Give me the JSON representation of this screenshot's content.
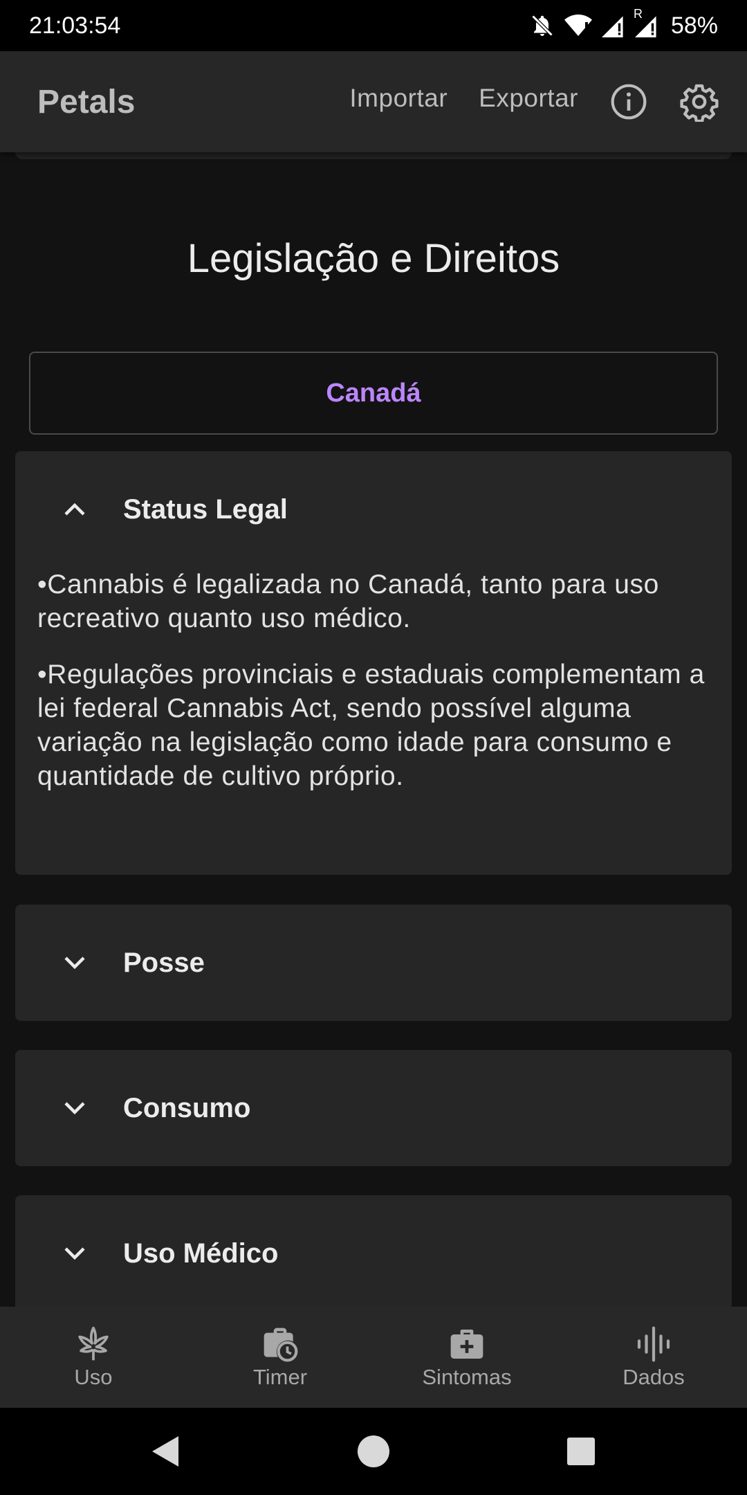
{
  "status_bar": {
    "time": "21:03:54",
    "battery": "58%",
    "signal_label": "R"
  },
  "app_bar": {
    "title": "Petals",
    "import_label": "Importar",
    "export_label": "Exportar"
  },
  "page": {
    "title": "Legislação e Direitos",
    "country": "Canadá"
  },
  "panels": [
    {
      "title": "Status Legal",
      "expanded": true,
      "paragraphs": [
        "•Cannabis é legalizada no Canadá, tanto para uso recreativo quanto uso médico.",
        "•Regulações provinciais e estaduais complementam a lei federal Cannabis Act, sendo possível alguma variação na legislação como idade para consumo e quantidade de cultivo próprio."
      ]
    },
    {
      "title": "Posse",
      "expanded": false
    },
    {
      "title": "Consumo",
      "expanded": false
    },
    {
      "title": "Uso Médico",
      "expanded": false
    }
  ],
  "bottom_nav": [
    {
      "label": "Uso",
      "icon": "cannabis-leaf-icon"
    },
    {
      "label": "Timer",
      "icon": "timer-bag-icon"
    },
    {
      "label": "Sintomas",
      "icon": "medical-kit-icon"
    },
    {
      "label": "Dados",
      "icon": "waveform-icon"
    }
  ],
  "colors": {
    "accent": "#bb86fc",
    "background": "#121212",
    "surface": "#262626"
  }
}
